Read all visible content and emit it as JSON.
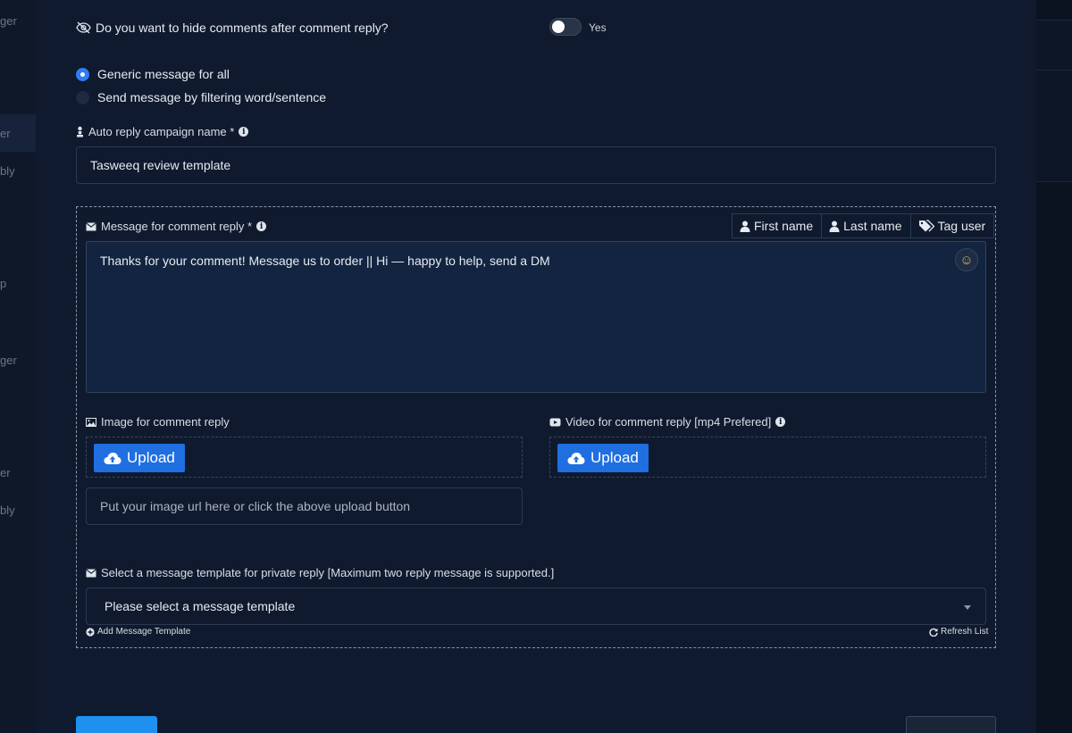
{
  "background": {
    "sidebar_fragments": [
      "ger",
      "er",
      "bly",
      "p",
      "ger",
      "er",
      "bly"
    ]
  },
  "hide_comments": {
    "question": "Do you want to hide comments after comment reply?",
    "toggle_label": "Yes",
    "toggle_on": false
  },
  "message_type": {
    "options": [
      {
        "label": "Generic message for all",
        "selected": true
      },
      {
        "label": "Send message by filtering word/sentence",
        "selected": false
      }
    ]
  },
  "campaign_name": {
    "label": "Auto reply campaign name *",
    "value": "Tasweeq review template"
  },
  "comment_reply": {
    "label": "Message for comment reply *",
    "variables": {
      "first_name": "First name",
      "last_name": "Last name",
      "tag_user": "Tag user"
    },
    "message": "Thanks for your comment! Message us to order || Hi — happy to help, send a DM"
  },
  "image_reply": {
    "label": "Image for comment reply",
    "upload_label": "Upload",
    "url_placeholder": "Put your image url here or click the above upload button"
  },
  "video_reply": {
    "label": "Video for comment reply [mp4 Prefered]",
    "upload_label": "Upload"
  },
  "private_reply": {
    "label": "Select a message template for private reply [Maximum two reply message is supported.]",
    "select_value": "Please select a message template",
    "add_template": "Add Message Template",
    "refresh_list": "Refresh List"
  },
  "colors": {
    "accent": "#1f6fe0",
    "background": "#0f1a2e",
    "textarea_bg": "#132441"
  }
}
